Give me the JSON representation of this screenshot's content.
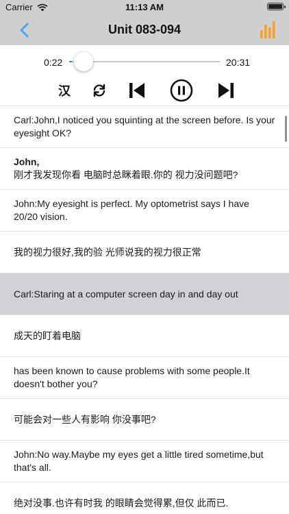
{
  "status_bar": {
    "carrier": "Carrier",
    "time": "11:13 AM"
  },
  "nav": {
    "title": "Unit 083-094",
    "back_icon": "chevron-left-icon",
    "stats_icon": "bar-chart-icon",
    "accent_color": "#4da3f7",
    "stats_color": "#f0a23a"
  },
  "player": {
    "current_time": "0:22",
    "total_time": "20:31",
    "progress": 0.018,
    "lang_toggle": "汉",
    "loop_icon": "repeat-icon",
    "prev_icon": "skip-back-icon",
    "pause_icon": "pause-circle-icon",
    "next_icon": "skip-forward-icon"
  },
  "sentences": [
    {
      "speaker": "",
      "text": "Carl:John,I noticed you squinting at the screen before. Is your eyesight OK?",
      "active": false
    },
    {
      "speaker": "John,",
      "text": "刚才我发现你看 电脑时总眯着眼.你的 视力没问题吧?",
      "active": false
    },
    {
      "speaker": "",
      "text": "John:My eyesight is perfect. My optometrist says I have 20/20 vision.",
      "active": false
    },
    {
      "speaker": "",
      "text": "我的视力很好,我的验 光师说我的视力很正常",
      "active": false
    },
    {
      "speaker": "",
      "text": "Carl:Staring at a computer screen day in and day out",
      "active": true
    },
    {
      "speaker": "",
      "text": "成天的盯着电脑",
      "active": false
    },
    {
      "speaker": "",
      "text": "has been known to cause problems with some people.It doesn't bother you?",
      "active": false
    },
    {
      "speaker": "",
      "text": "可能会对一些人有影响 你没事吧?",
      "active": false
    },
    {
      "speaker": "",
      "text": "John:No way.Maybe my eyes get a little tired sometime,but that's all.",
      "active": false
    },
    {
      "speaker": "",
      "text": "绝对没事.也许有时我 的眼睛会觉得累,但仅 此而已.",
      "active": false
    }
  ],
  "active_row_color": "#d2d2d6"
}
